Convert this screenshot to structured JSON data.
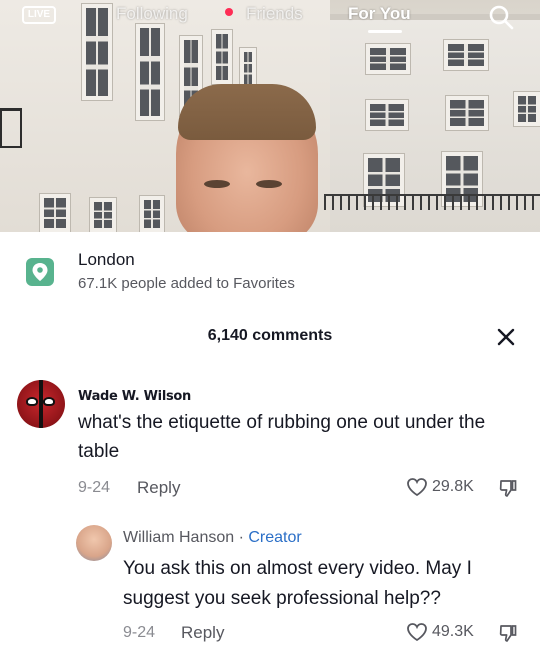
{
  "top_nav": {
    "live_label": "LIVE",
    "tabs": [
      "Following",
      "Friends",
      "For You"
    ],
    "active_tab": "For You"
  },
  "location": {
    "title": "London",
    "subtitle": "67.1K people added to Favorites"
  },
  "comments_header": {
    "count_label": "6,140 comments"
  },
  "comments": [
    {
      "author": "Wade W. Wilson",
      "text": "what's the etiquette of rubbing one out under the table",
      "date": "9-24",
      "reply_label": "Reply",
      "likes": "29.8K"
    },
    {
      "author": "William Hanson",
      "badge_separator": " · ",
      "badge": "Creator",
      "text": "You ask this on almost every video. May I suggest you seek professional help??",
      "date": "9-24",
      "reply_label": "Reply",
      "likes": "49.3K"
    }
  ],
  "colors": {
    "accent_red": "#fe2c55",
    "creator_blue": "#2b6fc7",
    "location_green": "#58b38e",
    "text_primary": "#161823",
    "text_secondary": "#57585f"
  }
}
